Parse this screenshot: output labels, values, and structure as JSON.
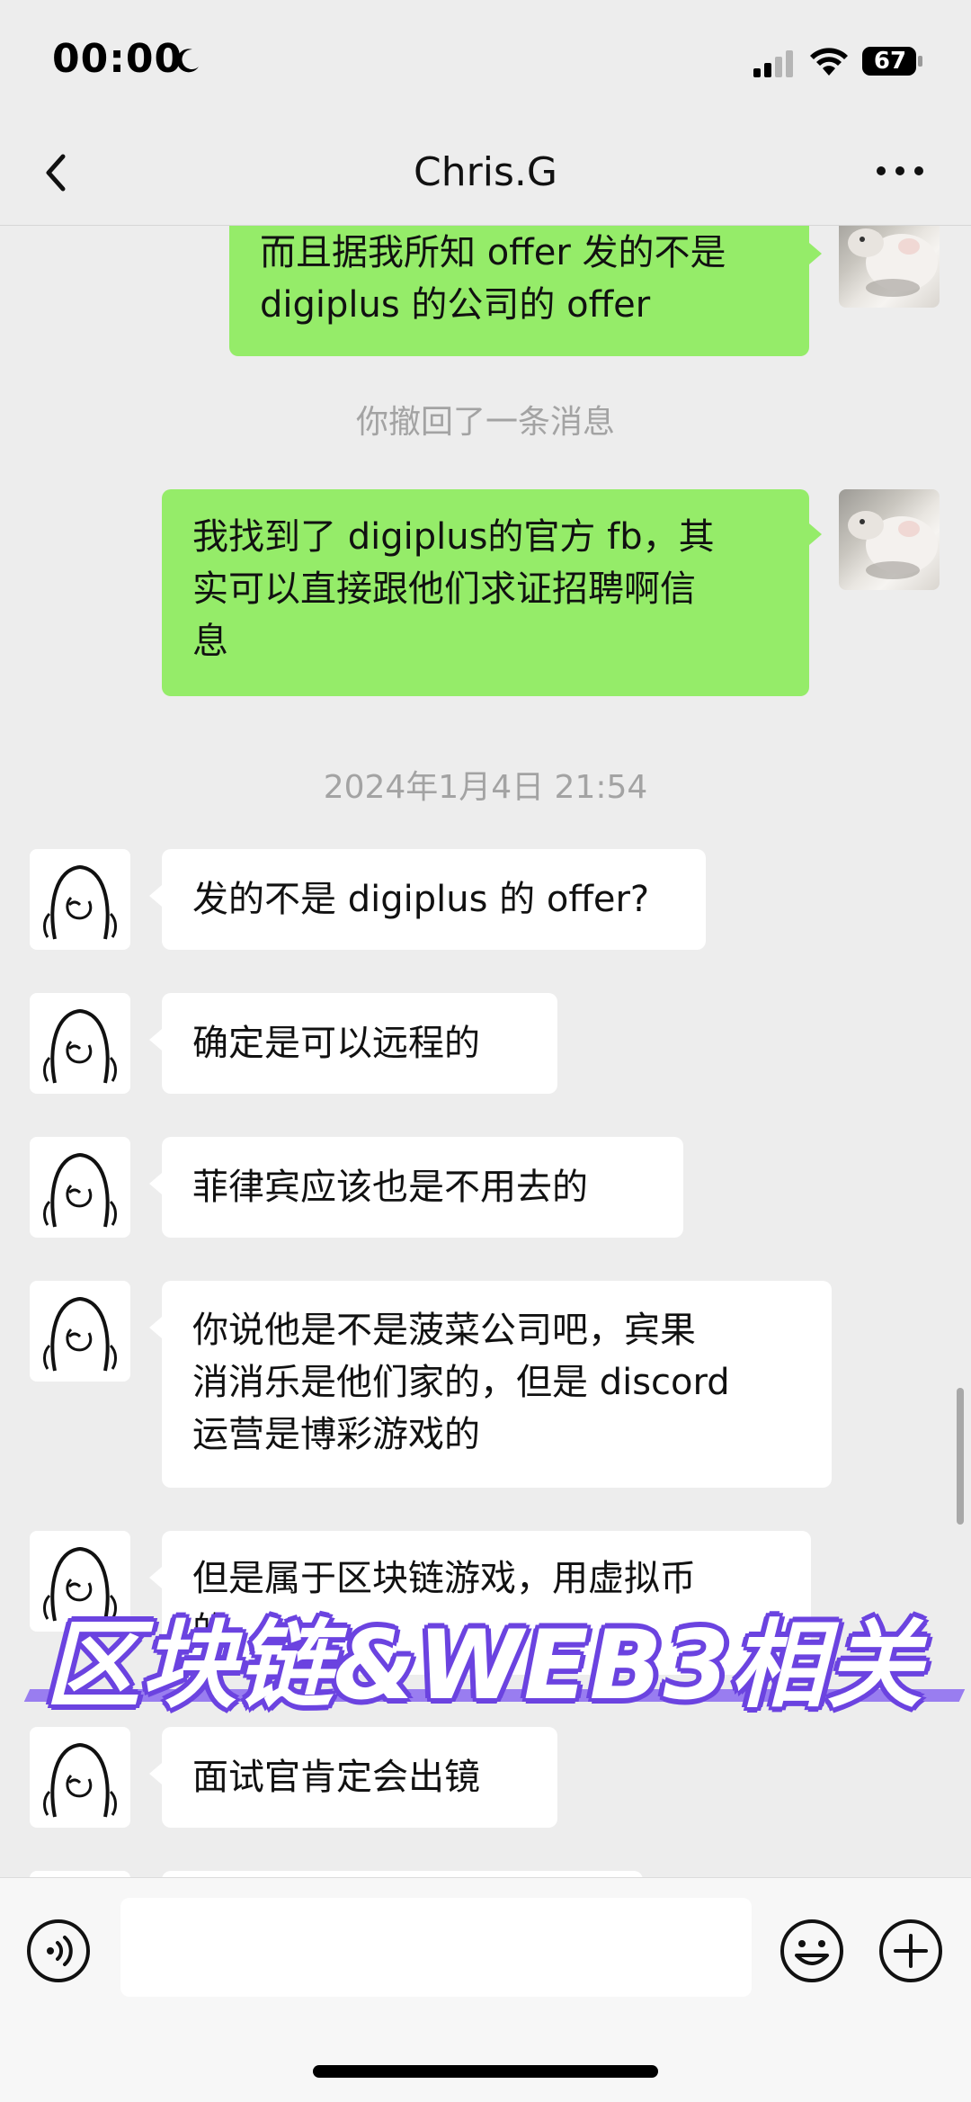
{
  "status_bar": {
    "time": "00:00",
    "moon_icon": "moon-icon",
    "signal_icon": "cellular-signal-icon",
    "wifi_icon": "wifi-icon",
    "battery_level": "67"
  },
  "nav": {
    "back_icon": "chevron-left-icon",
    "title": "Chris.G",
    "more_icon": "more-dots-icon"
  },
  "messages": [
    {
      "sender": "me",
      "lines": [
        "而且据我所知 offer 发的不是",
        "digiplus 的公司的 offer"
      ]
    },
    {
      "system": "你撤回了一条消息"
    },
    {
      "sender": "me",
      "lines": [
        "我找到了 digiplus的官方 fb，其",
        "实可以直接跟他们求证招聘啊信",
        "息"
      ]
    },
    {
      "system": "2024年1月4日 21:54"
    },
    {
      "sender": "other",
      "lines": [
        "发的不是 digiplus 的 offer?"
      ]
    },
    {
      "sender": "other",
      "lines": [
        "确定是可以远程的"
      ]
    },
    {
      "sender": "other",
      "lines": [
        "菲律宾应该也是不用去的"
      ]
    },
    {
      "sender": "other",
      "lines": [
        "你说他是不是菠菜公司吧，宾果",
        "消消乐是他们家的，但是 discord",
        "运营是博彩游戏的"
      ]
    },
    {
      "sender": "other",
      "lines": [
        "但是属于区块链游戏，用虚拟币",
        "的"
      ]
    },
    {
      "sender": "other",
      "lines": [
        "面试官肯定会出镜"
      ]
    }
  ],
  "watermark": "区块链&WEB3相关",
  "input_bar": {
    "voice_icon": "voice-icon",
    "input_value": "",
    "emoji_icon": "emoji-icon",
    "plus_icon": "plus-icon"
  },
  "colors": {
    "bg": "#ededed",
    "my_bubble": "#95ec69",
    "other_bubble": "#ffffff",
    "system_text": "#a3a3a3",
    "watermark_outline": "#6b43e0"
  }
}
